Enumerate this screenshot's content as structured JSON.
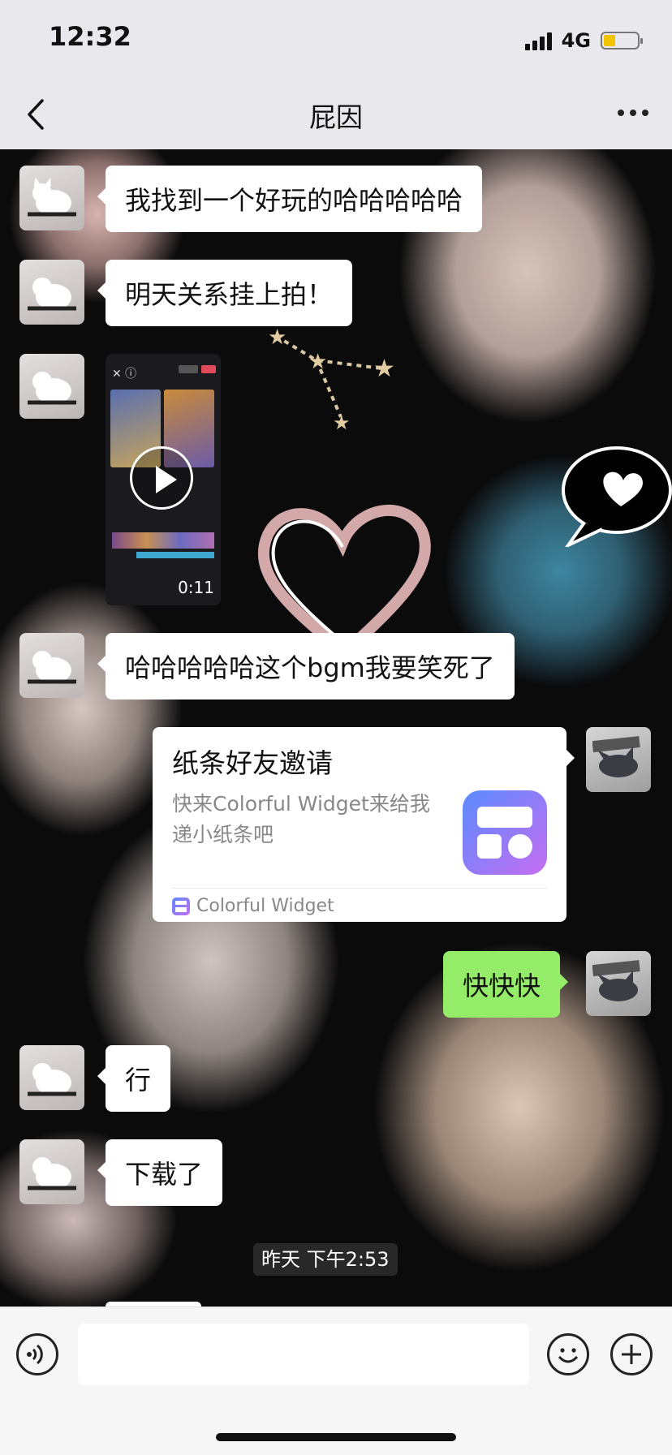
{
  "status_bar": {
    "time": "12:32",
    "network": "4G",
    "battery_level": 0.35
  },
  "nav": {
    "title": "屁因"
  },
  "messages": [
    {
      "side": "left",
      "sender": "contact",
      "text": "我找到一个好玩的哈哈哈哈哈"
    },
    {
      "side": "left",
      "sender": "contact",
      "text": "明天关系挂上拍！"
    },
    {
      "side": "left",
      "sender": "contact",
      "type": "video",
      "duration": "0:11"
    },
    {
      "side": "left",
      "sender": "contact",
      "text": "哈哈哈哈哈这个bgm我要笑死了"
    },
    {
      "side": "right",
      "sender": "me",
      "type": "card",
      "title": "纸条好友邀请",
      "desc": "快来Colorful Widget来给我递小纸条吧",
      "source": "Colorful Widget"
    },
    {
      "side": "right",
      "sender": "me",
      "text": "快快快"
    },
    {
      "side": "left",
      "sender": "contact",
      "text": "行"
    },
    {
      "side": "left",
      "sender": "contact",
      "text": "下载了"
    }
  ],
  "timestamp": "昨天 下午2:53",
  "input": {
    "value": "",
    "placeholder": ""
  },
  "icons": {
    "back": "chevron-left-icon",
    "more": "more-dots-icon",
    "voice": "voice-icon",
    "emoji": "emoji-icon",
    "plus": "plus-icon",
    "play": "play-icon"
  },
  "colors": {
    "my_bubble": "#95ec69",
    "other_bubble": "#ffffff",
    "battery": "#f2c500"
  }
}
